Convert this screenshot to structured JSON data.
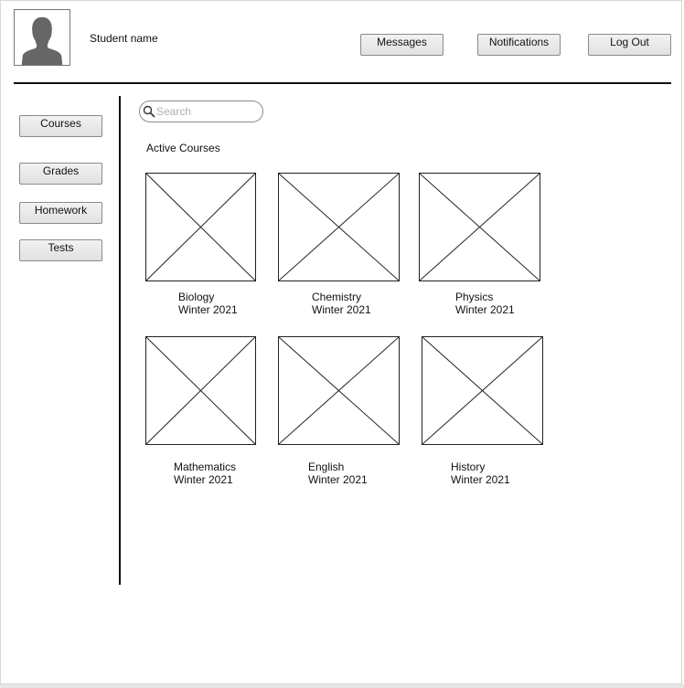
{
  "header": {
    "student_name": "Student name",
    "buttons": {
      "messages": "Messages",
      "notifications": "Notifications",
      "logout": "Log Out"
    }
  },
  "sidebar": {
    "items": [
      {
        "label": "Courses"
      },
      {
        "label": "Grades"
      },
      {
        "label": "Homework"
      },
      {
        "label": "Tests"
      }
    ]
  },
  "search": {
    "placeholder": "Search",
    "value": ""
  },
  "main": {
    "section_title": "Active Courses",
    "courses": [
      {
        "name": "Biology",
        "term": "Winter 2021"
      },
      {
        "name": "Chemistry",
        "term": "Winter 2021"
      },
      {
        "name": "Physics",
        "term": "Winter 2021"
      },
      {
        "name": "Mathematics",
        "term": "Winter 2021"
      },
      {
        "name": "English",
        "term": "Winter 2021"
      },
      {
        "name": "History",
        "term": "Winter 2021"
      }
    ]
  },
  "colors": {
    "line": "#111111",
    "button_bg": "#e6e6e6",
    "avatar_fill": "#666666"
  },
  "icons": {
    "avatar": "user-silhouette-icon",
    "search": "search-icon",
    "course_image": "image-placeholder-icon"
  }
}
